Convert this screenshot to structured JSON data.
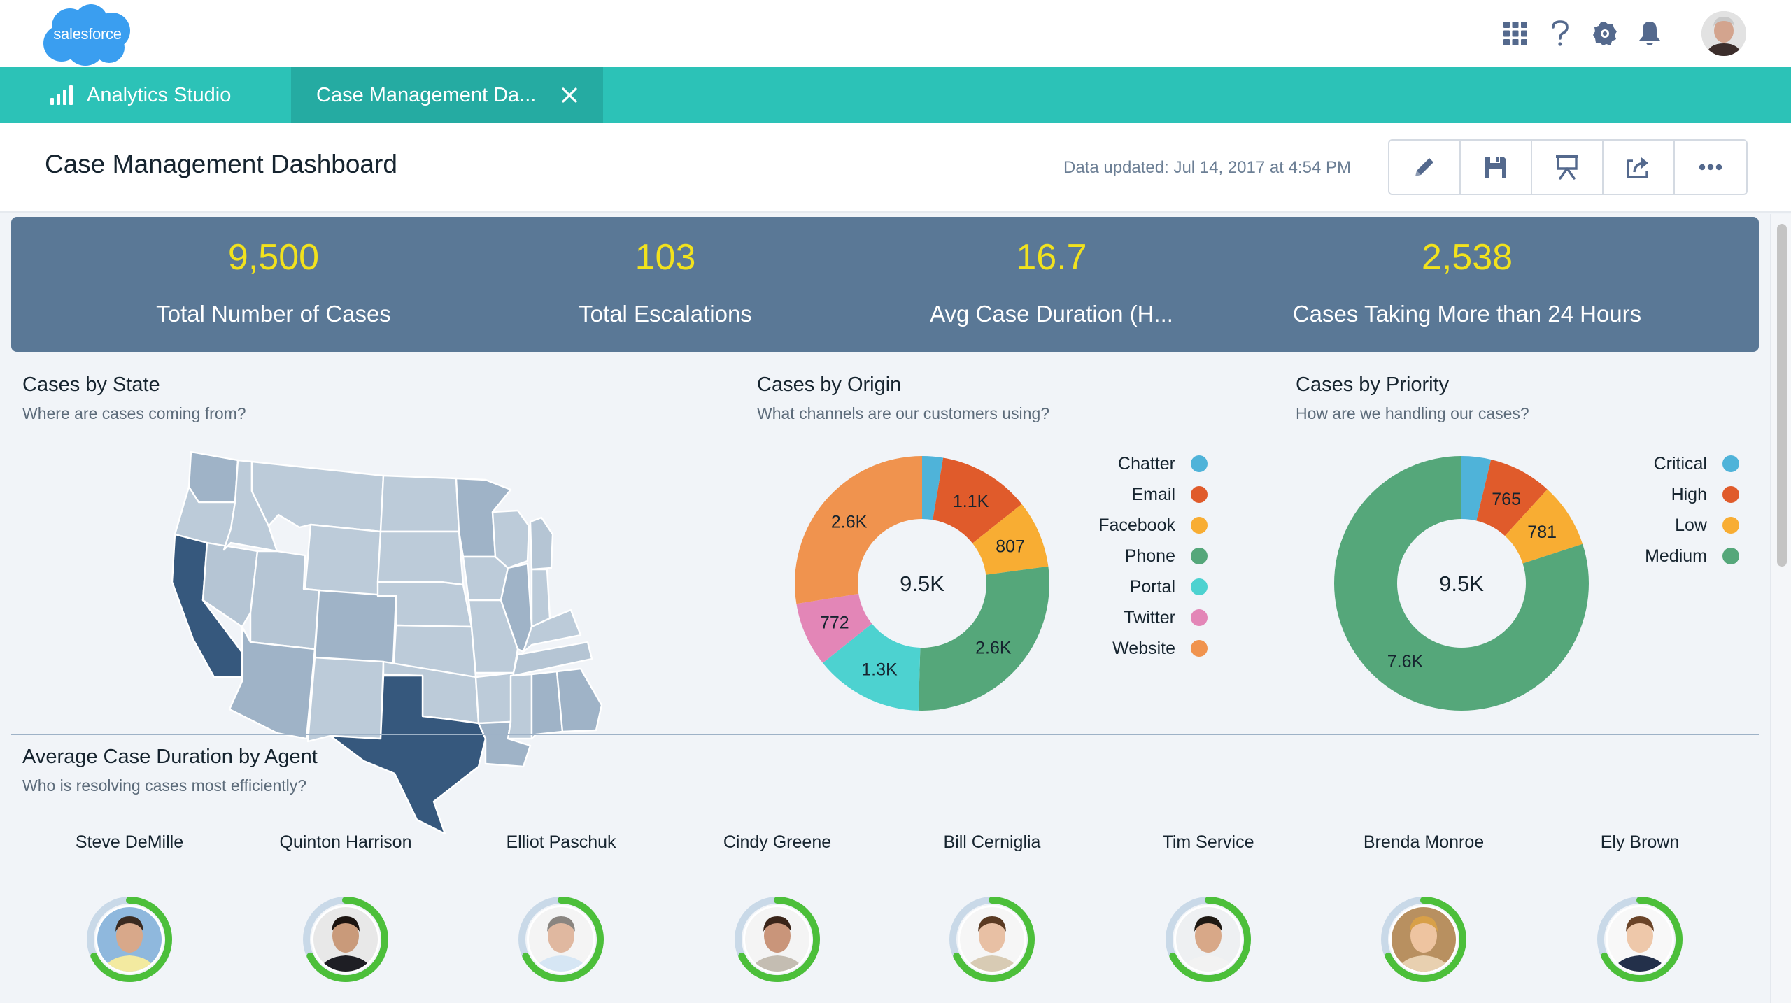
{
  "header": {
    "logo_text": "salesforce",
    "icons": [
      "app-launcher-icon",
      "help-icon",
      "settings-icon",
      "notifications-icon"
    ],
    "avatar": "user-avatar"
  },
  "tabs": {
    "app_name": "Analytics Studio",
    "active_tab": "Case Management Da..."
  },
  "page": {
    "title": "Case Management Dashboard",
    "updated": "Data updated: Jul 14, 2017 at 4:54 PM",
    "toolbar": [
      "edit-icon",
      "save-icon",
      "present-icon",
      "share-icon",
      "more-icon"
    ]
  },
  "kpis": [
    {
      "value": "9,500",
      "label": "Total Number of Cases"
    },
    {
      "value": "103",
      "label": "Total Escalations"
    },
    {
      "value": "16.7",
      "label": "Avg Case Duration (H..."
    },
    {
      "value": "2,538",
      "label": "Cases Taking More than 24 Hours"
    }
  ],
  "state_map": {
    "title": "Cases by State",
    "subtitle": "Where are cases coming from?"
  },
  "colors": {
    "teal": "#2cc2b7",
    "kpi_bg": "#5a7896",
    "kpi_value": "#f2e21d",
    "ring_fill": "#4cbf3a",
    "ring_track": "#c9d9e8"
  },
  "chart_data": [
    {
      "type": "pie",
      "variant": "donut",
      "title": "Cases by Origin",
      "subtitle": "What channels are our customers using?",
      "center_label": "9.5K",
      "categories": [
        "Chatter",
        "Email",
        "Facebook",
        "Phone",
        "Portal",
        "Twitter",
        "Website"
      ],
      "values": [
        250,
        1100,
        807,
        2600,
        1300,
        772,
        2600
      ],
      "data_labels": [
        "",
        "1.1K",
        "807",
        "2.6K",
        "1.3K",
        "772",
        "2.6K"
      ],
      "colors": [
        "#4fb3d9",
        "#e05b2b",
        "#f8ad33",
        "#55a77a",
        "#4dd2d0",
        "#e386b7",
        "#f0934e"
      ],
      "legend": "right"
    },
    {
      "type": "pie",
      "variant": "donut",
      "title": "Cases by Priority",
      "subtitle": "How are we handling our cases?",
      "center_label": "9.5K",
      "categories": [
        "Critical",
        "High",
        "Low",
        "Medium"
      ],
      "values": [
        354,
        765,
        781,
        7600
      ],
      "data_labels": [
        "",
        "765",
        "781",
        "7.6K"
      ],
      "colors": [
        "#4fb3d9",
        "#e05b2b",
        "#f8ad33",
        "#55a77a"
      ],
      "legend": "right"
    }
  ],
  "agents_section": {
    "title": "Average Case Duration by Agent",
    "subtitle": "Who is resolving cases most efficiently?",
    "agents": [
      {
        "name": "Steve DeMille",
        "progress": 0.68,
        "skin": "#d8a88a",
        "hair": "#3a2a20",
        "bg": "#8fb8dd",
        "shirt": "#f3eaa0"
      },
      {
        "name": "Quinton Harrison",
        "progress": 0.68,
        "skin": "#c99a7a",
        "hair": "#1c1410",
        "bg": "#e8e8e8",
        "shirt": "#1e1e24"
      },
      {
        "name": "Elliot Paschuk",
        "progress": 0.68,
        "skin": "#e0b8a0",
        "hair": "#8a8580",
        "bg": "#f4f4f4",
        "shirt": "#d6e6f4"
      },
      {
        "name": "Cindy Greene",
        "progress": 0.68,
        "skin": "#c9957a",
        "hair": "#3a2418",
        "bg": "#f4f4f4",
        "shirt": "#c4bdb2"
      },
      {
        "name": "Bill Cerniglia",
        "progress": 0.68,
        "skin": "#e8c0a4",
        "hair": "#5a3a22",
        "bg": "#f6f6f6",
        "shirt": "#d8cbb4"
      },
      {
        "name": "Tim Service",
        "progress": 0.68,
        "skin": "#d8a888",
        "hair": "#1e1812",
        "bg": "#eef0f2",
        "shirt": "#f2f2f2"
      },
      {
        "name": "Brenda Monroe",
        "progress": 0.68,
        "skin": "#eec4a0",
        "hair": "#d8a048",
        "bg": "#b89060",
        "shirt": "#e8d0b0"
      },
      {
        "name": "Ely Brown",
        "progress": 0.68,
        "skin": "#eec8aa",
        "hair": "#6a4428",
        "bg": "#f8f8f8",
        "shirt": "#23304a"
      }
    ]
  }
}
